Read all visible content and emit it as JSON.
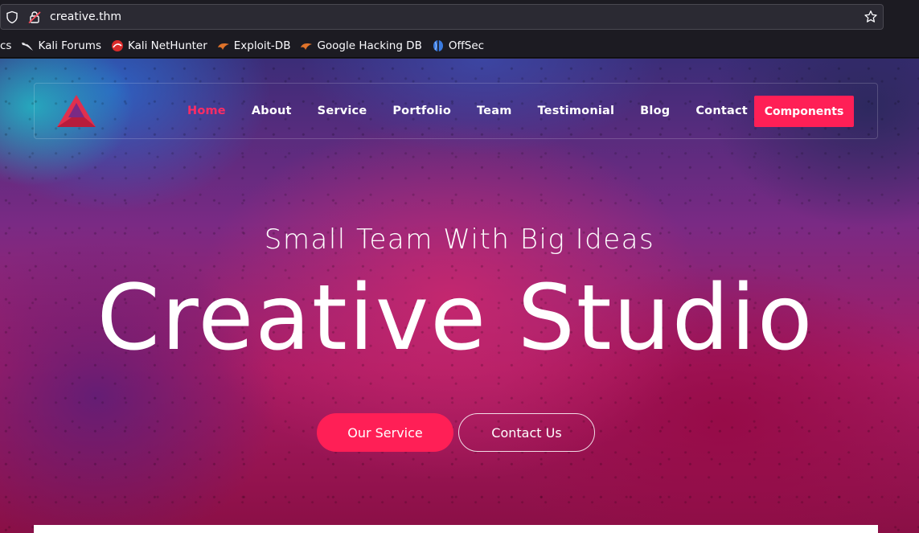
{
  "browser": {
    "url": "creative.thm",
    "bookmarks": [
      {
        "label": "cs",
        "icon": "none"
      },
      {
        "label": "Kali Forums",
        "icon": "kali-dragon-icon"
      },
      {
        "label": "Kali NetHunter",
        "icon": "nethunter-icon"
      },
      {
        "label": "Exploit-DB",
        "icon": "exploit-db-icon"
      },
      {
        "label": "Google Hacking DB",
        "icon": "ghdb-icon"
      },
      {
        "label": "OffSec",
        "icon": "offsec-icon"
      }
    ]
  },
  "nav": {
    "items": [
      {
        "label": "Home",
        "active": true
      },
      {
        "label": "About",
        "active": false
      },
      {
        "label": "Service",
        "active": false
      },
      {
        "label": "Portfolio",
        "active": false
      },
      {
        "label": "Team",
        "active": false
      },
      {
        "label": "Testimonial",
        "active": false
      },
      {
        "label": "Blog",
        "active": false
      },
      {
        "label": "Contact",
        "active": false
      }
    ],
    "components_label": "Components"
  },
  "hero": {
    "subtitle": "Small Team With Big Ideas",
    "title": "Creative Studio",
    "primary_button": "Our Service",
    "secondary_button": "Contact Us"
  },
  "colors": {
    "accent": "#ff1f56",
    "active_nav": "#ff2c64"
  }
}
